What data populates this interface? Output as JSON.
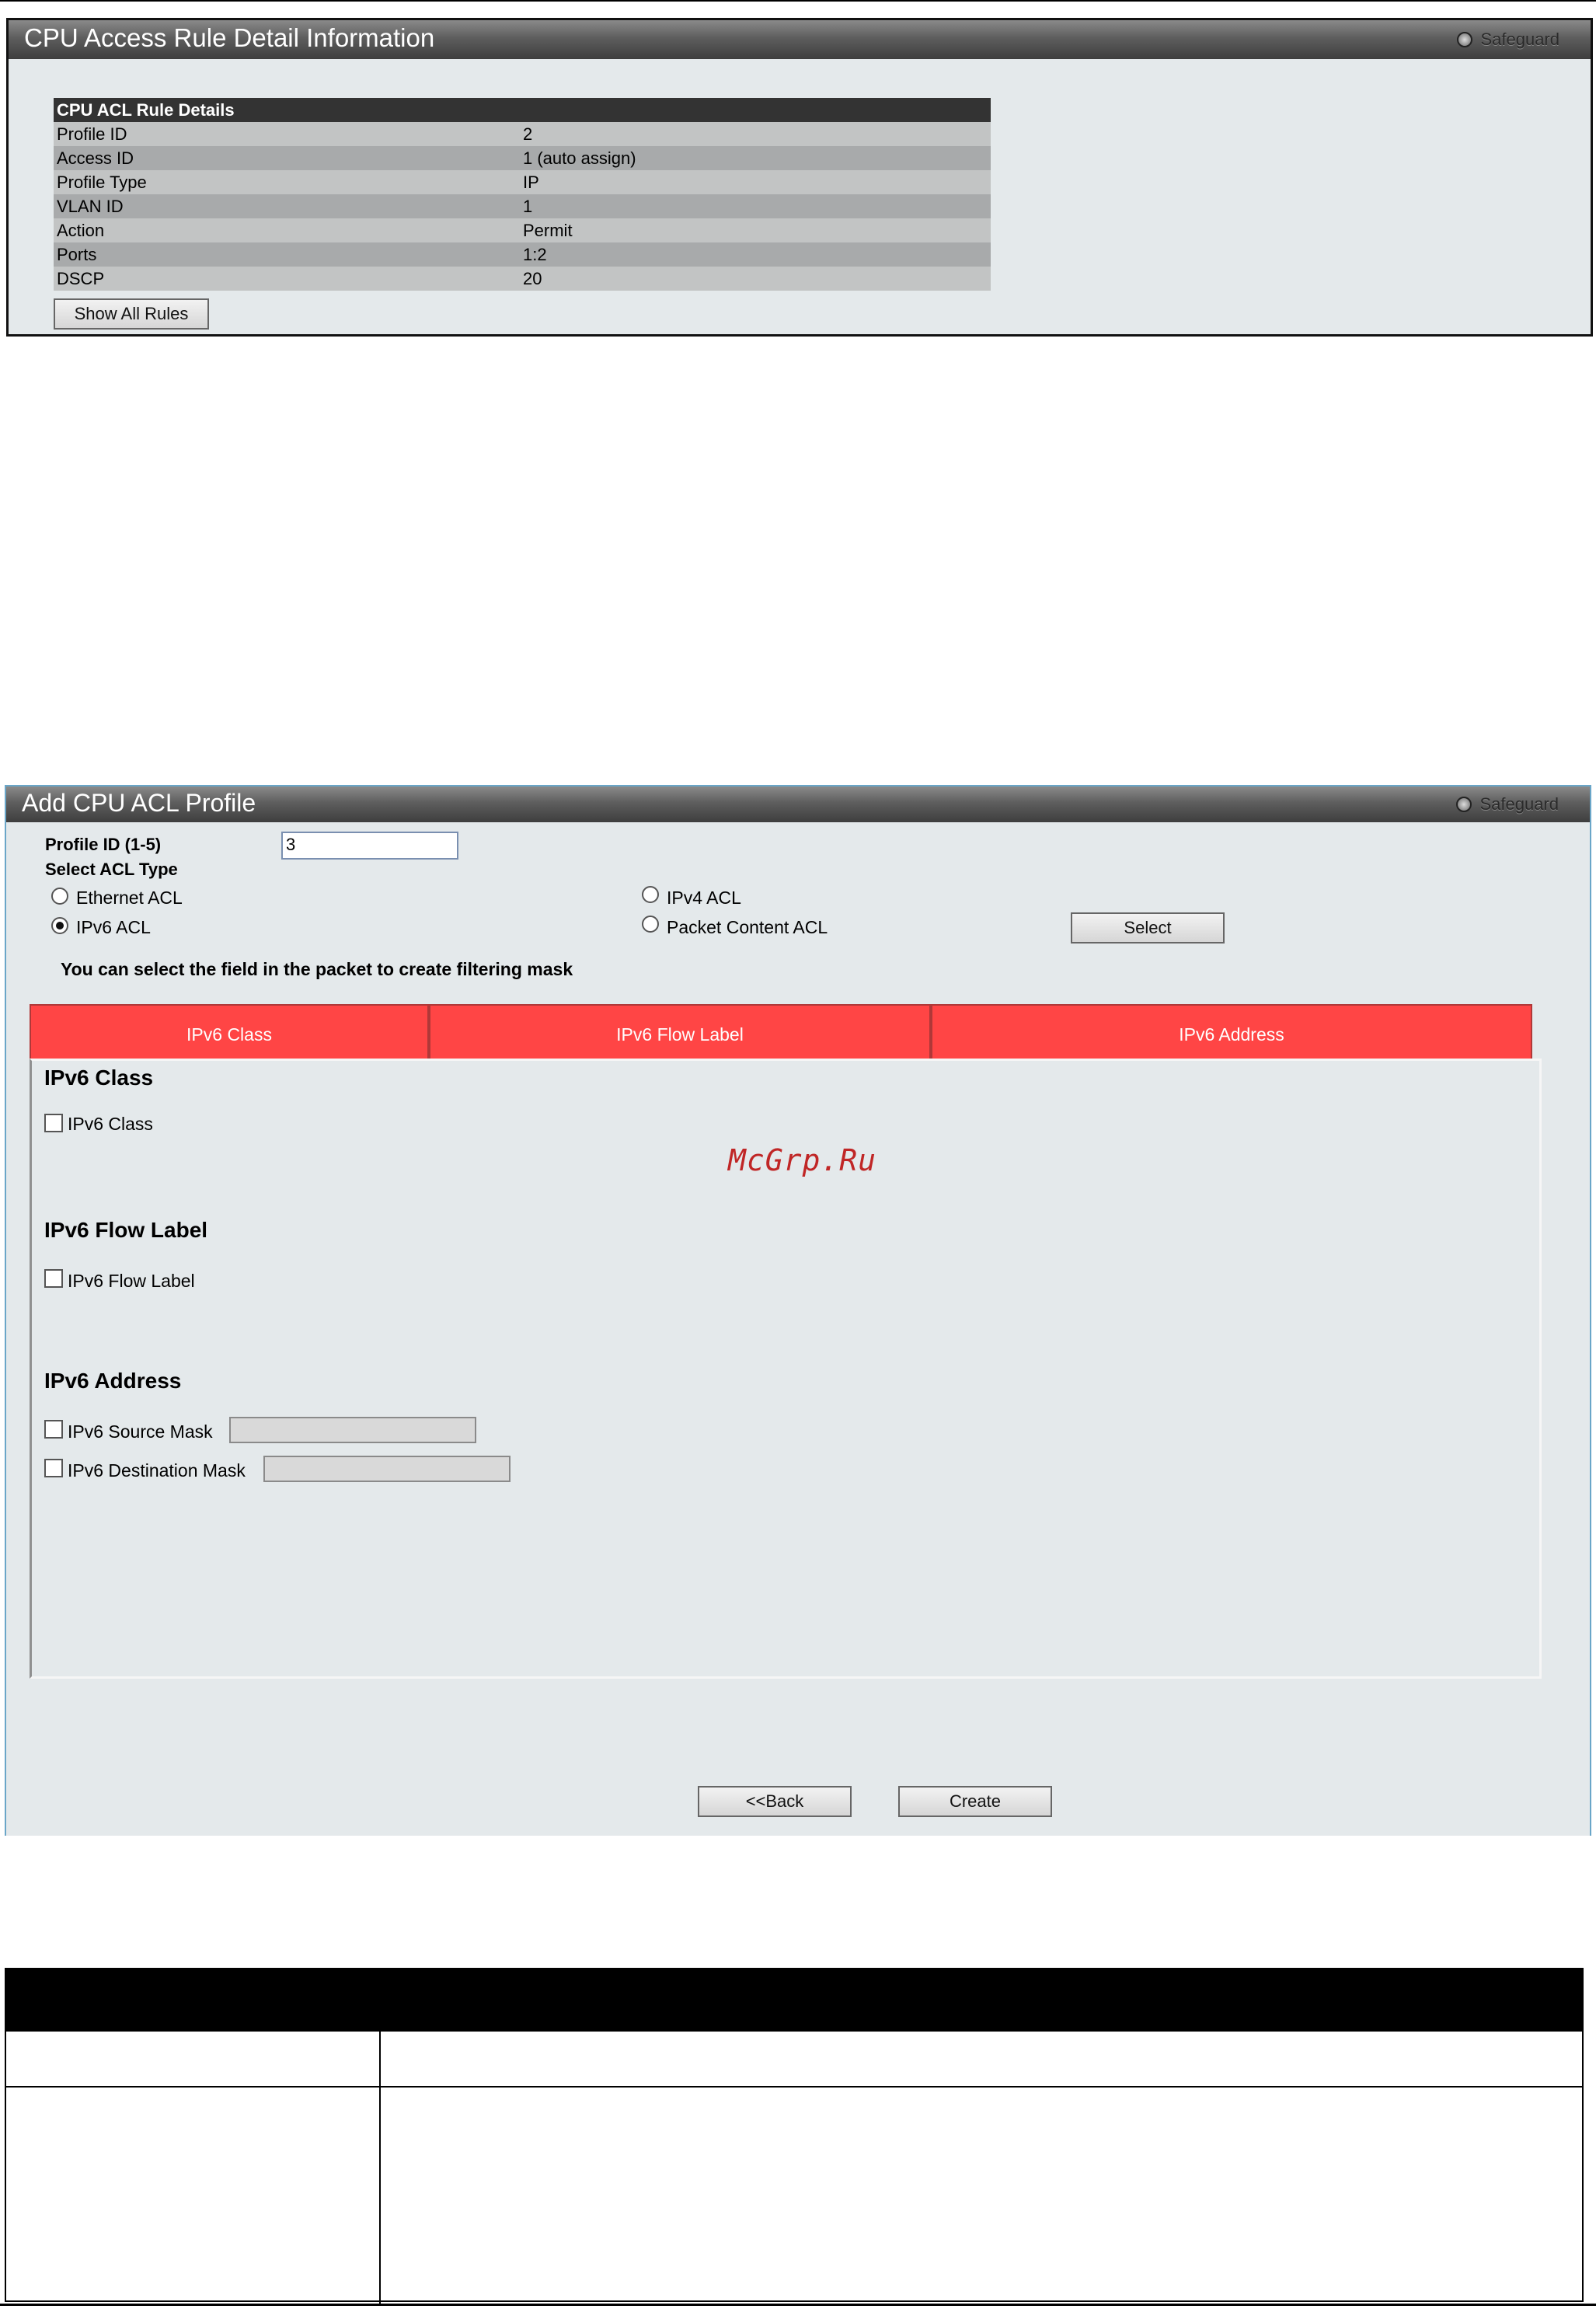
{
  "rule_detail": {
    "title": "CPU Access Rule Detail Information",
    "safeguard": "Safeguard",
    "table_header": "CPU ACL Rule Details",
    "rows": [
      {
        "label": "Profile ID",
        "value": "2"
      },
      {
        "label": "Access ID",
        "value": "1 (auto assign)"
      },
      {
        "label": "Profile Type",
        "value": "IP"
      },
      {
        "label": "VLAN ID",
        "value": "1"
      },
      {
        "label": "Action",
        "value": "Permit"
      },
      {
        "label": "Ports",
        "value": "1:2"
      },
      {
        "label": "DSCP",
        "value": "20"
      }
    ],
    "show_all_label": "Show All Rules"
  },
  "add_profile": {
    "title": "Add CPU ACL Profile",
    "safeguard": "Safeguard",
    "profile_id_label": "Profile ID (1-5)",
    "profile_id_value": "3",
    "select_type_label": "Select ACL Type",
    "acl_types": {
      "ethernet": "Ethernet ACL",
      "ipv4": "IPv4 ACL",
      "ipv6": "IPv6 ACL",
      "packet": "Packet Content ACL"
    },
    "selected_type": "IPv6 ACL",
    "select_button": "Select",
    "hint": "You can select the field in the packet to create filtering mask",
    "tabs": [
      "IPv6 Class",
      "IPv6 Flow Label",
      "IPv6 Address"
    ],
    "sections": {
      "class_heading": "IPv6 Class",
      "class_checkbox": "IPv6 Class",
      "flow_heading": "IPv6 Flow Label",
      "flow_checkbox": "IPv6 Flow Label",
      "address_heading": "IPv6 Address",
      "source_mask": "IPv6 Source Mask",
      "destination_mask": "IPv6 Destination Mask"
    },
    "back_button": "<<Back",
    "create_button": "Create"
  },
  "watermark": "McGrp.Ru",
  "colors": {
    "tab_red": "#ff4545",
    "panel_bg": "#e4e9eb",
    "header_dark": "#333333"
  }
}
